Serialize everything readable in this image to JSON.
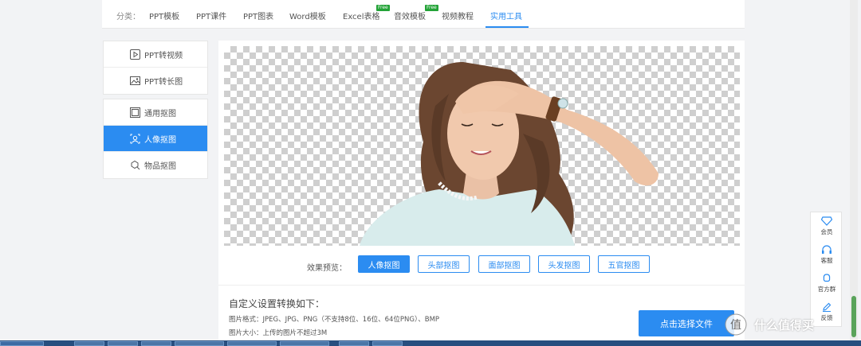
{
  "nav": {
    "category_label": "分类：",
    "items": [
      {
        "label": "PPT模板"
      },
      {
        "label": "PPT课件"
      },
      {
        "label": "PPT图表"
      },
      {
        "label": "Word模板"
      },
      {
        "label": "Excel表格",
        "badge": "Free"
      },
      {
        "label": "音效模板",
        "badge": "Free"
      },
      {
        "label": "视频教程"
      },
      {
        "label": "实用工具",
        "active": true
      }
    ]
  },
  "sidebar": {
    "group1": [
      {
        "label": "PPT转视频",
        "icon": "play-icon"
      },
      {
        "label": "PPT转长图",
        "icon": "image-icon"
      }
    ],
    "group2": [
      {
        "label": "通用抠图",
        "icon": "square-icon"
      },
      {
        "label": "人像抠图",
        "icon": "portrait-icon",
        "active": true
      },
      {
        "label": "物品抠图",
        "icon": "object-icon"
      }
    ]
  },
  "preview": {
    "label": "效果预览：",
    "buttons": [
      {
        "label": "人像抠图",
        "active": true
      },
      {
        "label": "头部抠图"
      },
      {
        "label": "面部抠图"
      },
      {
        "label": "头发抠图"
      },
      {
        "label": "五官抠图"
      }
    ]
  },
  "settings": {
    "title": "自定义设置转换如下：",
    "format_line": "图片格式：JPEG、JPG、PNG（不支持8位、16位、64位PNG）、BMP",
    "size_line": "图片大小：上传的图片不超过3M",
    "choose_button": "点击选择文件"
  },
  "float_bar": [
    {
      "label": "会员",
      "icon": "diamond-icon"
    },
    {
      "label": "客服",
      "icon": "headset-icon"
    },
    {
      "label": "官方群",
      "icon": "chat-icon"
    },
    {
      "label": "反馈",
      "icon": "edit-icon"
    }
  ],
  "watermark": {
    "text": "什么值得买",
    "logo": "值"
  },
  "colors": {
    "accent": "#2b8cf1",
    "free_badge": "#23a337"
  }
}
